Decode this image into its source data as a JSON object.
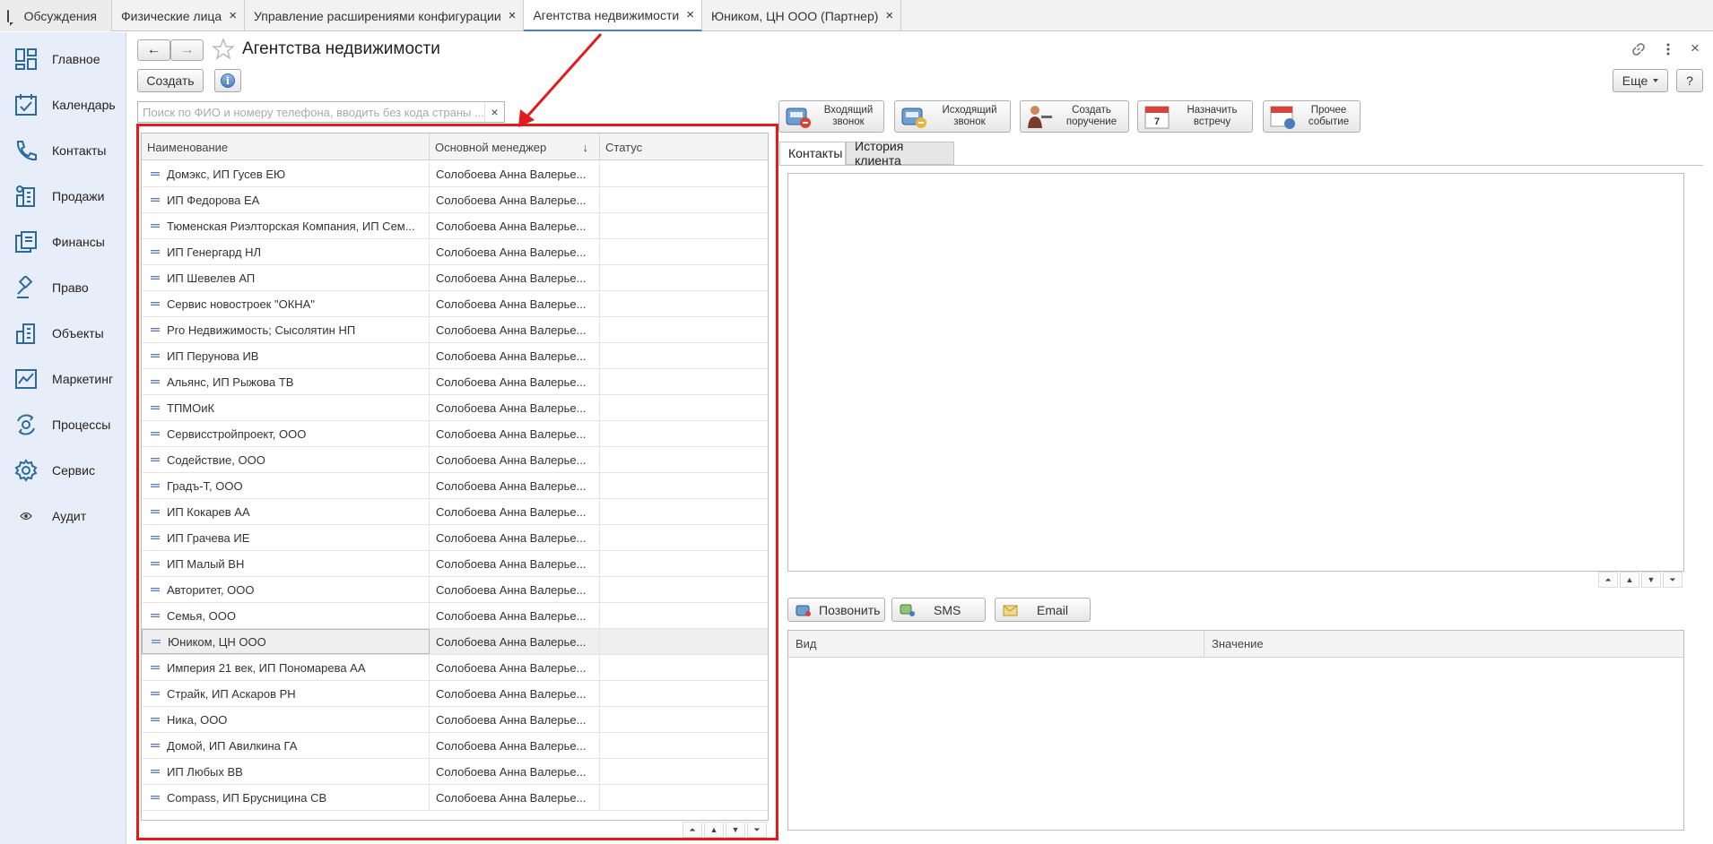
{
  "tabs": [
    {
      "label": "Обсуждения"
    },
    {
      "label": "Физические лица"
    },
    {
      "label": "Управление расширениями конфигурации"
    },
    {
      "label": "Агентства недвижимости"
    },
    {
      "label": "Юником, ЦН ООО (Партнер)"
    }
  ],
  "tab_close": "×",
  "sidebar": {
    "items": [
      {
        "label": "Главное",
        "icon": "dashboard-icon"
      },
      {
        "label": "Календарь",
        "icon": "calendar-icon"
      },
      {
        "label": "Контакты",
        "icon": "phone-icon"
      },
      {
        "label": "Продажи",
        "icon": "sales-icon"
      },
      {
        "label": "Финансы",
        "icon": "finance-icon"
      },
      {
        "label": "Право",
        "icon": "gavel-icon"
      },
      {
        "label": "Объекты",
        "icon": "buildings-icon"
      },
      {
        "label": "Маркетинг",
        "icon": "chart-icon"
      },
      {
        "label": "Процессы",
        "icon": "process-icon"
      },
      {
        "label": "Сервис",
        "icon": "gear-icon"
      },
      {
        "label": "Аудит",
        "icon": "eye-icon"
      }
    ]
  },
  "header": {
    "title": "Агентства недвижимости",
    "back": "←",
    "forward": "→",
    "create_label": "Создать",
    "more_label": "Еще",
    "help_label": "?",
    "close": "×"
  },
  "search": {
    "placeholder": "Поиск по ФИО и номеру телефона, вводить без кода страны ...",
    "clear": "×"
  },
  "list": {
    "columns": [
      "Наименование",
      "Основной менеджер",
      "Статус"
    ],
    "sort_indicator": "↓",
    "rows": [
      {
        "name": "Домэкс, ИП Гусев ЕЮ",
        "manager": "Солобоева Анна Валерье..."
      },
      {
        "name": "ИП Федорова ЕА",
        "manager": "Солобоева Анна Валерье..."
      },
      {
        "name": "Тюменская Риэлторская Компания, ИП Сем...",
        "manager": "Солобоева Анна Валерье..."
      },
      {
        "name": "ИП Генергард НЛ",
        "manager": "Солобоева Анна Валерье..."
      },
      {
        "name": "ИП Шевелев АП",
        "manager": "Солобоева Анна Валерье..."
      },
      {
        "name": "Сервис новостроек \"ОКНА\"",
        "manager": "Солобоева Анна Валерье..."
      },
      {
        "name": "Pro Недвижимость; Сысолятин НП",
        "manager": "Солобоева Анна Валерье..."
      },
      {
        "name": "ИП Перунова ИВ",
        "manager": "Солобоева Анна Валерье..."
      },
      {
        "name": "Альянс, ИП Рыжова ТВ",
        "manager": "Солобоева Анна Валерье..."
      },
      {
        "name": "ТПМОиК",
        "manager": "Солобоева Анна Валерье..."
      },
      {
        "name": "Сервисстройпроект, ООО",
        "manager": "Солобоева Анна Валерье..."
      },
      {
        "name": "Содействие, ООО",
        "manager": "Солобоева Анна Валерье..."
      },
      {
        "name": "Градъ-Т, ООО",
        "manager": "Солобоева Анна Валерье..."
      },
      {
        "name": "ИП Кокарев АА",
        "manager": "Солобоева Анна Валерье..."
      },
      {
        "name": "ИП Грачева ИЕ",
        "manager": "Солобоева Анна Валерье..."
      },
      {
        "name": "ИП Малый ВН",
        "manager": "Солобоева Анна Валерье..."
      },
      {
        "name": "Авторитет, ООО",
        "manager": "Солобоева Анна Валерье..."
      },
      {
        "name": "Семья, ООО",
        "manager": "Солобоева Анна Валерье..."
      },
      {
        "name": "Юником, ЦН ООО",
        "manager": "Солобоева Анна Валерье...",
        "selected": true
      },
      {
        "name": "Империя 21 век, ИП Пономарева АА",
        "manager": "Солобоева Анна Валерье..."
      },
      {
        "name": "Страйк, ИП Аскаров РН",
        "manager": "Солобоева Анна Валерье..."
      },
      {
        "name": "Ника, ООО",
        "manager": "Солобоева Анна Валерье..."
      },
      {
        "name": "Домой, ИП Авилкина ГА",
        "manager": "Солобоева Анна Валерье..."
      },
      {
        "name": "ИП Любых ВВ",
        "manager": "Солобоева Анна Валерье..."
      },
      {
        "name": "Compass, ИП Брусницина СВ",
        "manager": "Солобоева Анна Валерье..."
      }
    ]
  },
  "actions": [
    {
      "line1": "Входящий",
      "line2": "звонок",
      "icon": "incoming-call-icon"
    },
    {
      "line1": "Исходящий",
      "line2": "звонок",
      "icon": "outgoing-call-icon"
    },
    {
      "line1": "Создать",
      "line2": "поручение",
      "icon": "task-icon"
    },
    {
      "line1": "Назначить",
      "line2": "встречу",
      "icon": "meeting-icon"
    },
    {
      "line1": "Прочее",
      "line2": "событие",
      "icon": "event-icon"
    }
  ],
  "right_tabs": [
    "Контакты",
    "История клиента"
  ],
  "contact_buttons": [
    {
      "label": "Позвонить",
      "icon": "call-icon"
    },
    {
      "label": "SMS",
      "icon": "sms-icon"
    },
    {
      "label": "Email",
      "icon": "email-icon"
    }
  ],
  "info_columns": [
    "Вид",
    "Значение"
  ],
  "colors": {
    "highlight": "#e31b1b",
    "sidebar_bg": "#e7eefa",
    "accent": "#2b6a9b"
  }
}
